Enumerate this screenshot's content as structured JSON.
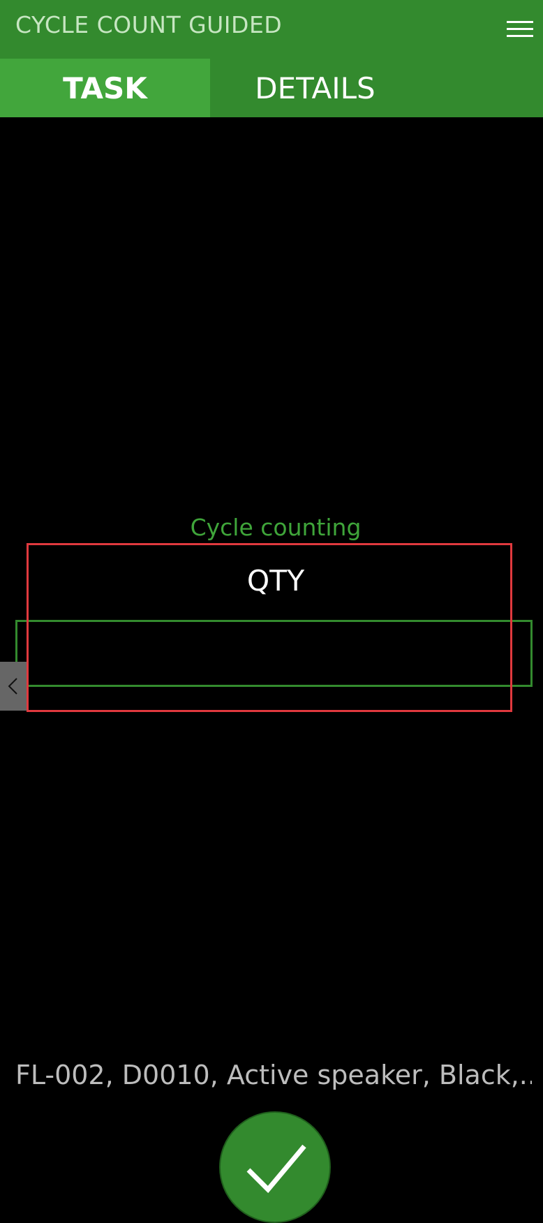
{
  "header": {
    "title": "CYCLE COUNT GUIDED",
    "menu_icon": "hamburger-menu-icon"
  },
  "tabs": [
    {
      "label": "TASK",
      "active": true
    },
    {
      "label": "DETAILS",
      "active": false
    }
  ],
  "main": {
    "section_label": "Cycle counting",
    "qty_label": "QTY",
    "qty_value": ""
  },
  "footer": {
    "item_description": "FL-002, D0010, Active speaker, Black,...",
    "confirm_icon": "checkmark-icon"
  },
  "colors": {
    "header_bg": "#338a2e",
    "active_tab_bg": "#42a63c",
    "accent_text": "#3fa53a",
    "highlight_border": "#e0393e",
    "background": "#000000"
  }
}
